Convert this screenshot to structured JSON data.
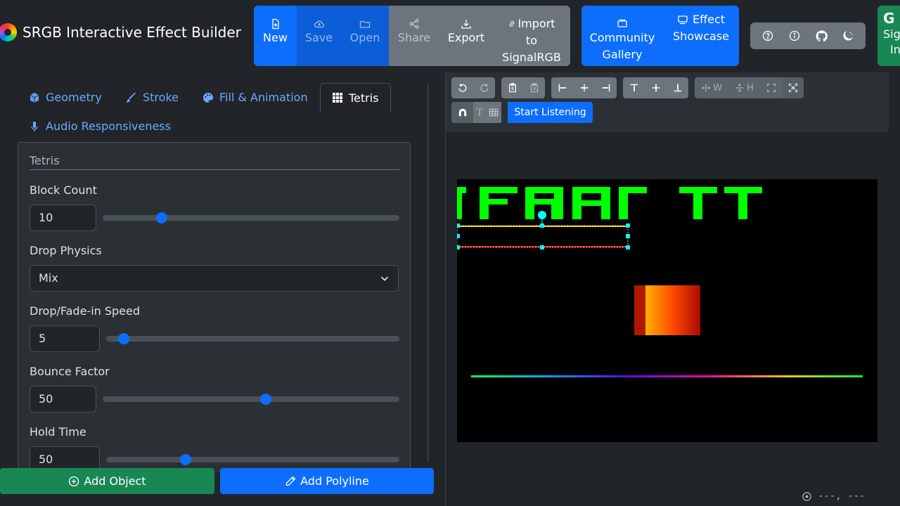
{
  "app": {
    "title": "SRGB Interactive Effect Builder"
  },
  "toolbar": {
    "new": "New",
    "save": "Save",
    "open": "Open",
    "share": "Share",
    "export": "Export",
    "import_line1": "Import",
    "import_line2": "to",
    "import_line3": "SignalRGB",
    "community_line1": "Community",
    "community_line2": "Gallery",
    "showcase_line1": "Effect",
    "showcase_line2": "Showcase",
    "signin_initial": "G",
    "signin_line1": "Sig",
    "signin_line2": "In"
  },
  "tabs": [
    {
      "label": "Geometry",
      "icon": "cube-icon"
    },
    {
      "label": "Stroke",
      "icon": "brush-icon"
    },
    {
      "label": "Fill & Animation",
      "icon": "palette-icon"
    },
    {
      "label": "Tetris",
      "icon": "grid-icon",
      "active": true
    },
    {
      "label": "Audio Responsiveness",
      "icon": "mic-icon"
    }
  ],
  "tetris": {
    "legend": "Tetris",
    "block_count": {
      "label": "Block Count",
      "value": "10",
      "fraction": 0.2
    },
    "drop_physics": {
      "label": "Drop Physics",
      "value": "Mix"
    },
    "drop_speed": {
      "label": "Drop/Fade-in Speed",
      "value": "5",
      "fraction": 0.06
    },
    "bounce_factor": {
      "label": "Bounce Factor",
      "value": "50",
      "fraction": 0.55
    },
    "hold_time": {
      "label": "Hold Time",
      "value": "50",
      "fraction": 0.27
    }
  },
  "actions": {
    "add_object": "Add Object",
    "add_polyline": "Add Polyline"
  },
  "canvas_toolbar": {
    "text_tool": "T",
    "distribute_w": "W",
    "distribute_h": "H",
    "start_listening": "Start Listening"
  },
  "canvas": {
    "text_fragment": "TFRAr TT",
    "text_color": "#00ff00"
  },
  "status": {
    "coords": "---, ---"
  },
  "colors": {
    "primary": "#0d6efd",
    "success": "#198754",
    "secondary": "#6c757d",
    "bg": "#212529"
  }
}
